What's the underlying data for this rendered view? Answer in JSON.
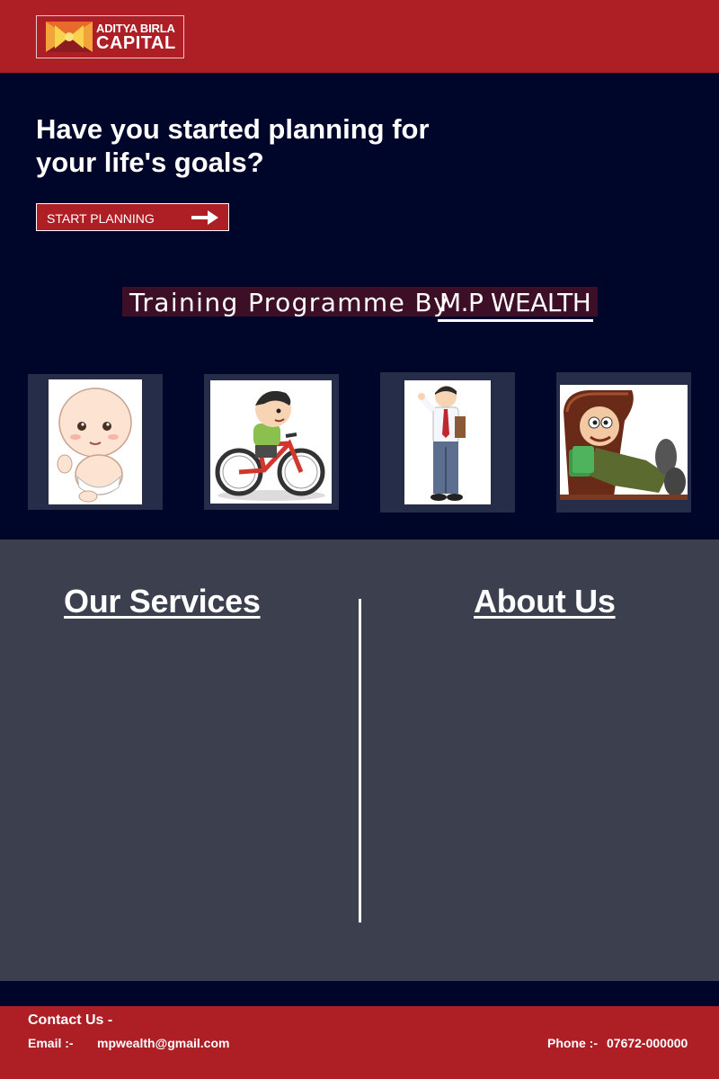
{
  "header": {
    "logo_line1": "ADITYA BIRLA",
    "logo_line2": "CAPITAL",
    "logo_icon": "aditya-birla-sun-logo-icon",
    "brand_color": "#ad1e25"
  },
  "hero": {
    "title_line1": "Have you started planning for",
    "title_line2": "your life's goals?",
    "cta_label": "START PLANNING",
    "cta_icon": "arrow-right-icon"
  },
  "training": {
    "label_part1": "Training Programme By",
    "label_part2": "M.P WEALTH"
  },
  "life_stages": [
    {
      "icon": "baby-illustration"
    },
    {
      "icon": "child-on-bicycle-illustration"
    },
    {
      "icon": "young-professional-illustration"
    },
    {
      "icon": "wealthy-retiree-illustration"
    }
  ],
  "sections": {
    "services_title": "Our Services",
    "about_title": "About Us"
  },
  "footer": {
    "contact_title": "Contact Us -",
    "email_label": "Email :-",
    "email_value": "mpwealth@gmail.com",
    "phone_label": "Phone :-",
    "phone_value": "07672-000000"
  },
  "colors": {
    "navy_bg": "#00052a",
    "tile_bg": "#262d49",
    "services_bg": "#3c3f4d",
    "training_bg": "#3d0f26"
  }
}
